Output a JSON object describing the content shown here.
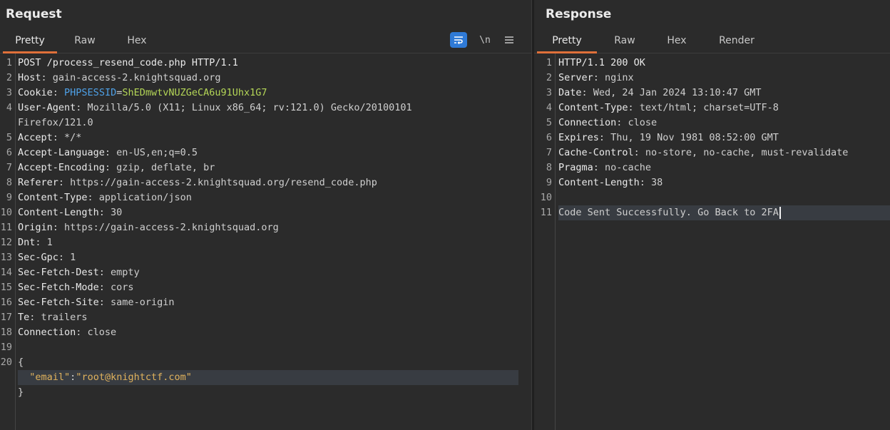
{
  "request": {
    "title": "Request",
    "tabs": [
      "Pretty",
      "Raw",
      "Hex"
    ],
    "active_tab": "Pretty",
    "toolbar": {
      "wrap_icon": "wrap-lines-icon",
      "newline_label": "\\n",
      "menu_icon": "hamburger-menu-icon"
    },
    "line_numbers": [
      "1",
      "2",
      "3",
      "4",
      "",
      "5",
      "6",
      "7",
      "8",
      "9",
      "10",
      "11",
      "12",
      "13",
      "14",
      "15",
      "16",
      "17",
      "18",
      "19",
      "20",
      "",
      ""
    ],
    "lines": [
      {
        "key": "POST /process_resend_code.php HTTP/1.1",
        "val": ""
      },
      {
        "key": "Host",
        "val": ": gain-access-2.knightsquad.org"
      },
      {
        "key": "Cookie",
        "val": ": ",
        "cookie_name": "PHPSESSID",
        "cookie_eq": "=",
        "cookie_val": "ShEDmwtvNUZGeCA6u91Uhx1G7"
      },
      {
        "key": "User-Agent",
        "val": ": Mozilla/5.0 (X11; Linux x86_64; rv:121.0) Gecko/20100101"
      },
      {
        "key": "",
        "val": "Firefox/121.0"
      },
      {
        "key": "Accept",
        "val": ": */*"
      },
      {
        "key": "Accept-Language",
        "val": ": en-US,en;q=0.5"
      },
      {
        "key": "Accept-Encoding",
        "val": ": gzip, deflate, br"
      },
      {
        "key": "Referer",
        "val": ": https://gain-access-2.knightsquad.org/resend_code.php"
      },
      {
        "key": "Content-Type",
        "val": ": application/json"
      },
      {
        "key": "Content-Length",
        "val": ": 30"
      },
      {
        "key": "Origin",
        "val": ": https://gain-access-2.knightsquad.org"
      },
      {
        "key": "Dnt",
        "val": ": 1"
      },
      {
        "key": "Sec-Gpc",
        "val": ": 1"
      },
      {
        "key": "Sec-Fetch-Dest",
        "val": ": empty"
      },
      {
        "key": "Sec-Fetch-Mode",
        "val": ": cors"
      },
      {
        "key": "Sec-Fetch-Site",
        "val": ": same-origin"
      },
      {
        "key": "Te",
        "val": ": trailers"
      },
      {
        "key": "Connection",
        "val": ": close"
      },
      {
        "key": "",
        "val": ""
      },
      {
        "key": "",
        "val": "{"
      },
      {
        "key": "",
        "val": "",
        "json_key": "\"email\"",
        "json_colon": ":",
        "json_val": "\"root@knightctf.com\""
      },
      {
        "key": "",
        "val": "}"
      }
    ]
  },
  "response": {
    "title": "Response",
    "tabs": [
      "Pretty",
      "Raw",
      "Hex",
      "Render"
    ],
    "active_tab": "Pretty",
    "line_numbers": [
      "1",
      "2",
      "3",
      "4",
      "5",
      "6",
      "7",
      "8",
      "9",
      "10",
      "11"
    ],
    "lines": [
      {
        "key": "HTTP/1.1 200 OK",
        "val": ""
      },
      {
        "key": "Server",
        "val": ": nginx"
      },
      {
        "key": "Date",
        "val": ": Wed, 24 Jan 2024 13:10:47 GMT"
      },
      {
        "key": "Content-Type",
        "val": ": text/html; charset=UTF-8"
      },
      {
        "key": "Connection",
        "val": ": close"
      },
      {
        "key": "Expires",
        "val": ": Thu, 19 Nov 1981 08:52:00 GMT"
      },
      {
        "key": "Cache-Control",
        "val": ": no-store, no-cache, must-revalidate"
      },
      {
        "key": "Pragma",
        "val": ": no-cache"
      },
      {
        "key": "Content-Length",
        "val": ": 38"
      },
      {
        "key": "",
        "val": ""
      },
      {
        "key": "",
        "val": "Code Sent Successfully. Go Back to 2FA"
      }
    ]
  },
  "colors": {
    "background": "#2b2b2b",
    "active_tab_underline": "#e0703a",
    "wrap_button": "#2f7ad6",
    "cookie_name": "#4ea0e6",
    "cookie_value": "#b4d657",
    "json_string": "#e0b25c"
  }
}
